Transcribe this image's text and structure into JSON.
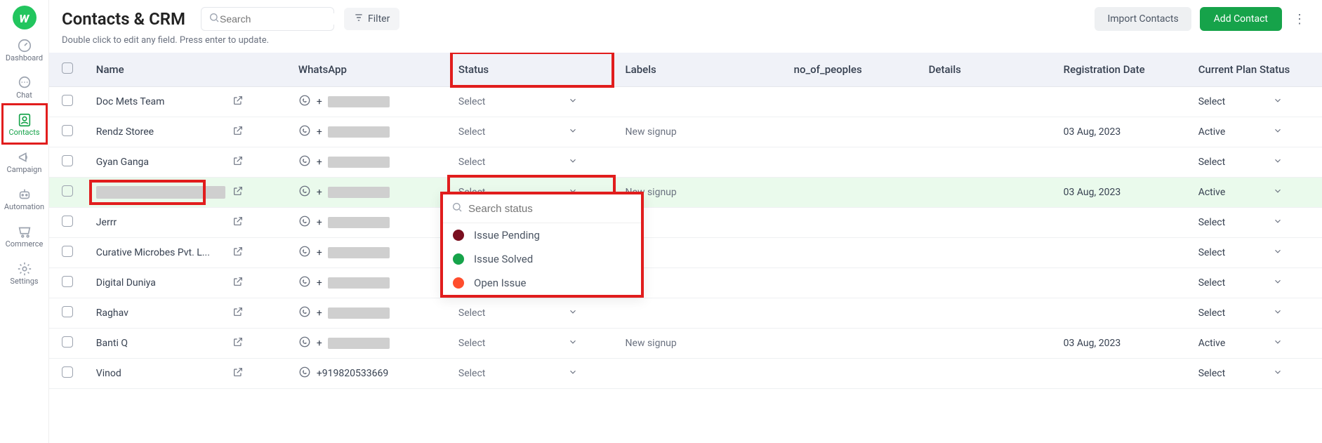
{
  "sidebar": {
    "items": [
      {
        "label": "Dashboard"
      },
      {
        "label": "Chat"
      },
      {
        "label": "Contacts"
      },
      {
        "label": "Campaign"
      },
      {
        "label": "Automation"
      },
      {
        "label": "Commerce"
      },
      {
        "label": "Settings"
      }
    ]
  },
  "header": {
    "title": "Contacts & CRM",
    "search_placeholder": "Search",
    "filter_label": "Filter",
    "import_label": "Import Contacts",
    "add_label": "Add Contact",
    "subtitle": "Double click to edit any field. Press enter to update."
  },
  "columns": {
    "name": "Name",
    "whatsapp": "WhatsApp",
    "status": "Status",
    "labels": "Labels",
    "nop": "no_of_peoples",
    "details": "Details",
    "reg": "Registration Date",
    "plan": "Current Plan Status"
  },
  "status_placeholder": "Select",
  "plan_placeholder": "Select",
  "rows": [
    {
      "name": "Doc Mets Team",
      "wa_redacted": true,
      "wa": "+",
      "labels": "",
      "reg": "",
      "plan": "Select"
    },
    {
      "name": "Rendz Storee",
      "wa_redacted": true,
      "wa": "+",
      "labels": "New signup",
      "reg": "03 Aug, 2023",
      "plan": "Active"
    },
    {
      "name": "Gyan Ganga",
      "wa_redacted": true,
      "wa": "+",
      "labels": "",
      "reg": "",
      "plan": "Select"
    },
    {
      "name": "",
      "name_redacted": true,
      "wa_redacted": true,
      "wa": "+",
      "labels": "New signup",
      "reg": "03 Aug, 2023",
      "plan": "Active",
      "highlight": true,
      "status_redwrap": true
    },
    {
      "name": "Jerrr",
      "wa_redacted": true,
      "wa": "+",
      "labels": "",
      "reg": "",
      "plan": "Select"
    },
    {
      "name": "Curative Microbes Pvt. L...",
      "wa_redacted": true,
      "wa": "+",
      "labels": "",
      "reg": "",
      "plan": "Select"
    },
    {
      "name": "Digital Duniya",
      "wa_redacted": true,
      "wa": "+",
      "labels": "",
      "reg": "",
      "plan": "Select"
    },
    {
      "name": "Raghav",
      "wa_redacted": true,
      "wa": "+",
      "labels": "",
      "reg": "",
      "plan": "Select"
    },
    {
      "name": "Banti Q",
      "wa_redacted": true,
      "wa": "+",
      "labels": "New signup",
      "reg": "03 Aug, 2023",
      "plan": "Active"
    },
    {
      "name": "Vinod",
      "wa_redacted": false,
      "wa": "+919820533669",
      "labels": "",
      "reg": "",
      "plan": "Select"
    }
  ],
  "status_dropdown": {
    "search_placeholder": "Search status",
    "options": [
      {
        "label": "Issue Pending",
        "color": "#7a0f1f"
      },
      {
        "label": "Issue Solved",
        "color": "#16a34a"
      },
      {
        "label": "Open Issue",
        "color": "#ff4d2d"
      }
    ]
  }
}
